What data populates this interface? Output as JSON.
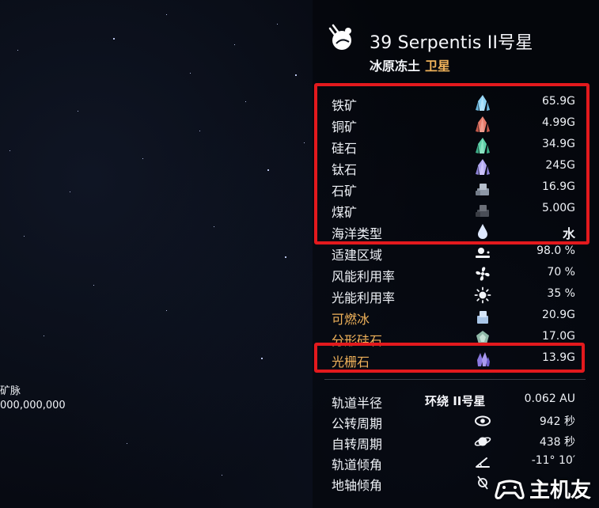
{
  "left_hud": {
    "line1": "矿脉",
    "line2": "000,000,000"
  },
  "header": {
    "title": "39 Serpentis II号星",
    "subtitle_main": "冰原冻土",
    "subtitle_accent": "卫星",
    "icon": "satellite-icon"
  },
  "resources": [
    {
      "label": "铁矿",
      "value": "65.9G",
      "icon": "blue-crystal-icon",
      "color": "#8fd3f4"
    },
    {
      "label": "铜矿",
      "value": "4.99G",
      "icon": "red-crystal-icon",
      "color": "#e67a6a"
    },
    {
      "label": "硅石",
      "value": "34.9G",
      "icon": "green-crystal-icon",
      "color": "#5fd0a8"
    },
    {
      "label": "钛石",
      "value": "245G",
      "icon": "purple-crystal-icon",
      "color": "#b3a9f2"
    },
    {
      "label": "石矿",
      "value": "16.9G",
      "icon": "stone-icon",
      "color": "#a7b1bf"
    },
    {
      "label": "煤矿",
      "value": "5.00G",
      "icon": "coal-icon",
      "color": "#6b6f78"
    },
    {
      "label": "海洋类型",
      "value": "水",
      "icon": "water-drop-icon",
      "color": "#dfe9ff"
    }
  ],
  "stats": [
    {
      "label": "适建区域",
      "value": "98.0 %",
      "icon": "terrain-icon"
    },
    {
      "label": "风能利用率",
      "value": "70 %",
      "icon": "wind-icon"
    },
    {
      "label": "光能利用率",
      "value": "35 %",
      "icon": "sun-icon"
    }
  ],
  "special": [
    {
      "label": "可燃冰",
      "value": "20.9G",
      "icon": "fire-ice-icon",
      "orange": true
    },
    {
      "label": "分形硅石",
      "value": "17.0G",
      "icon": "fractal-silicon-icon",
      "orange": true
    },
    {
      "label": "光栅石",
      "value": "13.9G",
      "icon": "grating-crystal-icon",
      "orange": true
    }
  ],
  "orbit": [
    {
      "label": "轨道半径",
      "mid": "环绕 II号星",
      "value": "0.062 AU",
      "icon": ""
    },
    {
      "label": "公转周期",
      "mid": "",
      "value": "942 秒",
      "icon": "eye-orbit-icon"
    },
    {
      "label": "自转周期",
      "mid": "",
      "value": "438 秒",
      "icon": "planet-ring-icon"
    },
    {
      "label": "轨道倾角",
      "mid": "",
      "value": "-11° 10′",
      "icon": "angle-icon"
    },
    {
      "label": "地轴倾角",
      "mid": "",
      "value": "",
      "icon": "axis-icon"
    }
  ],
  "watermark": {
    "text": "主机友"
  },
  "highlight_color": "#e3191d",
  "accent_color": "#f0b25a"
}
